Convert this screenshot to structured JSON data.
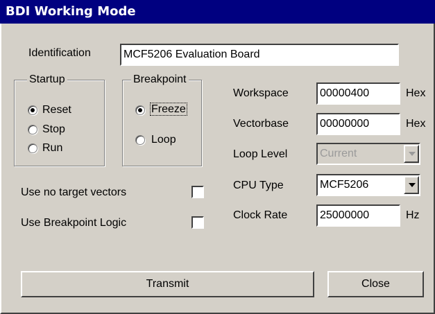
{
  "window": {
    "title": "BDI Working Mode"
  },
  "identification": {
    "label": "Identification",
    "value": "MCF5206 Evaluation Board"
  },
  "startup": {
    "legend": "Startup",
    "options": [
      {
        "label": "Reset",
        "selected": true
      },
      {
        "label": "Stop",
        "selected": false
      },
      {
        "label": "Run",
        "selected": false
      }
    ]
  },
  "breakpoint": {
    "legend": "Breakpoint",
    "options": [
      {
        "label": "Freeze",
        "selected": true
      },
      {
        "label": "Loop",
        "selected": false
      }
    ]
  },
  "workspace": {
    "label": "Workspace",
    "value": "00000400",
    "unit": "Hex"
  },
  "vectorbase": {
    "label": "Vectorbase",
    "value": "00000000",
    "unit": "Hex"
  },
  "loop_level": {
    "label": "Loop Level",
    "value": "Current",
    "disabled": true
  },
  "cpu_type": {
    "label": "CPU Type",
    "value": "MCF5206"
  },
  "clock_rate": {
    "label": "Clock Rate",
    "value": "25000000",
    "unit": "Hz"
  },
  "no_target_vectors": {
    "label": "Use no target vectors",
    "checked": false
  },
  "breakpoint_logic": {
    "label": "Use Breakpoint Logic",
    "checked": false
  },
  "buttons": {
    "transmit": "Transmit",
    "close": "Close"
  }
}
